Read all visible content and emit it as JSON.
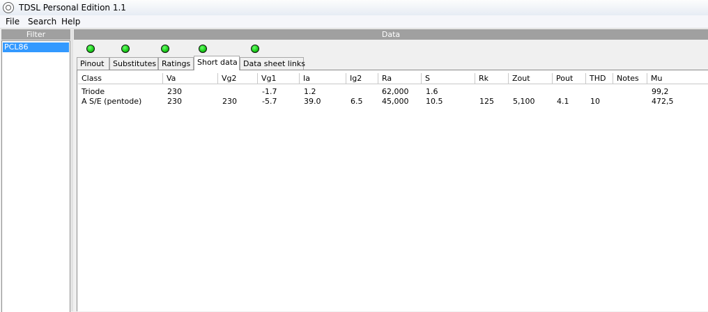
{
  "window": {
    "title": "TDSL Personal Edition 1.1"
  },
  "menu": {
    "items": [
      "File",
      "Search",
      "Help"
    ]
  },
  "filter_panel": {
    "header": "Filter",
    "items": [
      "PCL86"
    ]
  },
  "data_panel": {
    "header": "Data"
  },
  "indicator_color": "#22cc22",
  "tabs": [
    "Pinout",
    "Substitutes",
    "Ratings",
    "Short data",
    "Data sheet links"
  ],
  "active_tab": "Short data",
  "table": {
    "columns": [
      "Class",
      "Va",
      "Vg2",
      "Vg1",
      "Ia",
      "Ig2",
      "Ra",
      "S",
      "Rk",
      "Zout",
      "Pout",
      "THD",
      "Notes",
      "Mu"
    ],
    "rows": [
      [
        "Triode",
        "230",
        "",
        "-1.7",
        "1.2",
        "",
        "62,000",
        "1.6",
        "",
        "",
        "",
        "",
        "",
        "99,2"
      ],
      [
        "A S/E (pentode)",
        "230",
        "230",
        "-5.7",
        "39.0",
        "6.5",
        "45,000",
        "10.5",
        "125",
        "5,100",
        "4.1",
        "10",
        "",
        "472,5"
      ]
    ]
  }
}
